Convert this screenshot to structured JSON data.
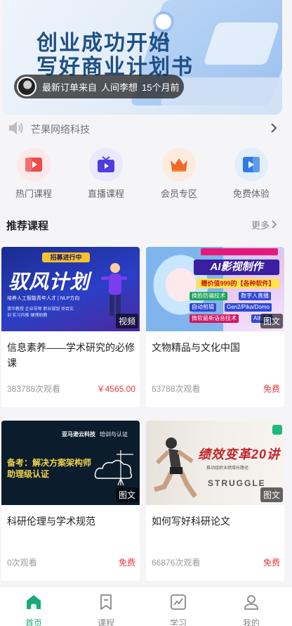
{
  "banner": {
    "title_line1": "创业成功开始",
    "title_line2": "写好商业计划书",
    "order_ticker": {
      "prefix": "最新订单来自",
      "user": "人间李想",
      "time": "15个月前"
    }
  },
  "notice": {
    "text": "芒果网络科技"
  },
  "shortcuts": [
    {
      "label": "热门课程",
      "icon": "hot-course-icon",
      "bg": "#fde8ea",
      "color": "#f04a4a"
    },
    {
      "label": "直播课程",
      "icon": "live-tv-icon",
      "bg": "#e9e8fd",
      "color": "#4e3ce0"
    },
    {
      "label": "会员专区",
      "icon": "crown-icon",
      "bg": "#fdebdf",
      "color": "#f06a26"
    },
    {
      "label": "免费体验",
      "icon": "free-trial-icon",
      "bg": "#e3eefc",
      "color": "#2f7be8"
    }
  ],
  "section": {
    "title": "推荐课程",
    "more": "更多"
  },
  "courses": [
    {
      "title": "信息素养——学术研究的必修课",
      "views": "383788次观看",
      "price": "￥4565.00",
      "tag": "视频",
      "thumb": {
        "header": "招募进行中",
        "headline": "驭风计划",
        "sub": "培养人工智能青年人才 | NLP方向",
        "lines": "清华教授 企业导师 职业规划 项目实训 实习内推 硬博助教"
      }
    },
    {
      "title": "文物精品与文化中国",
      "views": "63788次观看",
      "price": "免费",
      "tag": "图文",
      "thumb": {
        "headline": "AI影视制作",
        "gift": "赠价值999的【各种软件】",
        "ribbons": [
          "换脸防骗技术",
          "数字人直播",
          "自动剪辑",
          "Gen2/Pika/Domo",
          "微软最新语音技术",
          "AI绘画"
        ]
      }
    },
    {
      "title": "科研伦理与学术规范",
      "views": "0次观看",
      "price": "免费",
      "tag": "图文",
      "thumb": {
        "brand": "亚马逊云科技",
        "brand2": "培训与认证",
        "headline": "备考：解决方案架构师助理级认证"
      }
    },
    {
      "title": "如何写好科研论文",
      "views": "66876次观看",
      "price": "免费",
      "tag": "图文",
      "thumb": {
        "headline": "绩效变革20讲",
        "sub": "推动组织业绩增长路径",
        "word": "STRUGGLE"
      }
    }
  ],
  "tabbar": [
    {
      "label": "首页",
      "icon": "home-icon",
      "active": true
    },
    {
      "label": "课程",
      "icon": "bookmark-icon",
      "active": false
    },
    {
      "label": "学习",
      "icon": "study-chart-icon",
      "active": false
    },
    {
      "label": "我的",
      "icon": "user-icon",
      "active": false
    }
  ],
  "colors": {
    "accent": "#19a97c",
    "price": "#e4393c"
  }
}
